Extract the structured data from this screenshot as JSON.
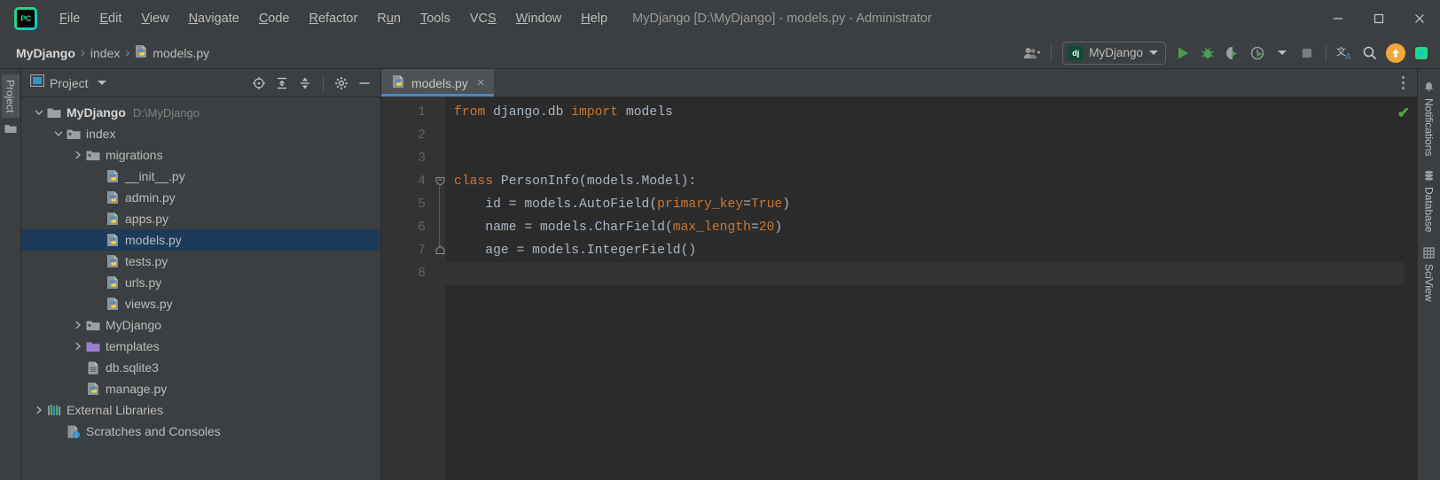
{
  "window": {
    "title": "MyDjango [D:\\MyDjango] - models.py - Administrator",
    "logo_text": "PC",
    "minimize_label": "Minimize",
    "maximize_label": "Maximize",
    "close_label": "Close"
  },
  "menubar": {
    "items": [
      {
        "label": "File",
        "mnemonic": "F"
      },
      {
        "label": "Edit",
        "mnemonic": "E"
      },
      {
        "label": "View",
        "mnemonic": "V"
      },
      {
        "label": "Navigate",
        "mnemonic": "N"
      },
      {
        "label": "Code",
        "mnemonic": "C"
      },
      {
        "label": "Refactor",
        "mnemonic": "R"
      },
      {
        "label": "Run",
        "mnemonic": "u"
      },
      {
        "label": "Tools",
        "mnemonic": "T"
      },
      {
        "label": "VCS",
        "mnemonic": "S"
      },
      {
        "label": "Window",
        "mnemonic": "W"
      },
      {
        "label": "Help",
        "mnemonic": "H"
      }
    ]
  },
  "breadcrumb": {
    "items": [
      {
        "label": "MyDjango",
        "icon": "none",
        "bold": true
      },
      {
        "label": "index",
        "icon": "none",
        "bold": false
      },
      {
        "label": "models.py",
        "icon": "python-file-icon",
        "bold": false
      }
    ],
    "separator": "›"
  },
  "toolbar": {
    "avatar_label": "Account",
    "run_config": {
      "label": "MyDjango",
      "icon_text": "dj"
    },
    "buttons": [
      {
        "name": "run-button",
        "label": "Run"
      },
      {
        "name": "debug-button",
        "label": "Debug"
      },
      {
        "name": "run-with-coverage-button",
        "label": "Run with Coverage"
      },
      {
        "name": "profile-button",
        "label": "Profile"
      },
      {
        "name": "stop-button",
        "label": "Stop"
      },
      {
        "name": "translate-button",
        "label": "Translate"
      },
      {
        "name": "search-everywhere-button",
        "label": "Search Everywhere"
      },
      {
        "name": "update-project-button",
        "label": "Update Project"
      }
    ]
  },
  "left_toolwindow_bar": {
    "tabs": [
      {
        "label": "Project",
        "icon": "folder-icon",
        "active": true
      }
    ]
  },
  "project_panel": {
    "title": "Project",
    "actions": [
      {
        "name": "select-opened-file-action",
        "label": "Select Opened File"
      },
      {
        "name": "expand-all-action",
        "label": "Expand All"
      },
      {
        "name": "collapse-all-action",
        "label": "Collapse All"
      },
      {
        "name": "settings-action",
        "label": "Settings"
      },
      {
        "name": "hide-action",
        "label": "Hide"
      }
    ],
    "tree": [
      {
        "label": "MyDjango",
        "path": "D:\\MyDjango",
        "indent": 0,
        "arrow": "down",
        "icon": "folder-icon",
        "bold": true,
        "selected": false
      },
      {
        "label": "index",
        "path": "",
        "indent": 1,
        "arrow": "down",
        "icon": "module-folder-icon",
        "bold": false,
        "selected": false
      },
      {
        "label": "migrations",
        "path": "",
        "indent": 2,
        "arrow": "right",
        "icon": "module-folder-icon",
        "bold": false,
        "selected": false
      },
      {
        "label": "__init__.py",
        "path": "",
        "indent": 3,
        "arrow": "none",
        "icon": "python-file-icon",
        "bold": false,
        "selected": false
      },
      {
        "label": "admin.py",
        "path": "",
        "indent": 3,
        "arrow": "none",
        "icon": "python-file-icon",
        "bold": false,
        "selected": false
      },
      {
        "label": "apps.py",
        "path": "",
        "indent": 3,
        "arrow": "none",
        "icon": "python-file-icon",
        "bold": false,
        "selected": false
      },
      {
        "label": "models.py",
        "path": "",
        "indent": 3,
        "arrow": "none",
        "icon": "python-file-icon",
        "bold": false,
        "selected": true
      },
      {
        "label": "tests.py",
        "path": "",
        "indent": 3,
        "arrow": "none",
        "icon": "python-file-icon",
        "bold": false,
        "selected": false
      },
      {
        "label": "urls.py",
        "path": "",
        "indent": 3,
        "arrow": "none",
        "icon": "python-file-icon",
        "bold": false,
        "selected": false
      },
      {
        "label": "views.py",
        "path": "",
        "indent": 3,
        "arrow": "none",
        "icon": "python-file-icon",
        "bold": false,
        "selected": false
      },
      {
        "label": "MyDjango",
        "path": "",
        "indent": 2,
        "arrow": "right",
        "icon": "module-folder-icon",
        "bold": false,
        "selected": false
      },
      {
        "label": "templates",
        "path": "",
        "indent": 2,
        "arrow": "right",
        "icon": "templates-folder-icon",
        "bold": false,
        "selected": false
      },
      {
        "label": "db.sqlite3",
        "path": "",
        "indent": 2,
        "arrow": "none",
        "icon": "database-file-icon",
        "bold": false,
        "selected": false
      },
      {
        "label": "manage.py",
        "path": "",
        "indent": 2,
        "arrow": "none",
        "icon": "python-file-icon",
        "bold": false,
        "selected": false
      },
      {
        "label": "External Libraries",
        "path": "",
        "indent": 0,
        "arrow": "right",
        "icon": "libraries-icon",
        "bold": false,
        "selected": false
      },
      {
        "label": "Scratches and Consoles",
        "path": "",
        "indent": 1,
        "arrow": "none",
        "icon": "scratches-icon",
        "bold": false,
        "selected": false
      }
    ]
  },
  "editor": {
    "tabs": [
      {
        "label": "models.py",
        "icon": "python-file-icon",
        "active": true,
        "close": "×"
      }
    ],
    "options_label": "Options",
    "inspection_status": "✔",
    "lines": [
      {
        "num": "1",
        "fold": "none",
        "current": false,
        "tokens": [
          {
            "t": "from ",
            "c": "kw"
          },
          {
            "t": "django.db ",
            "c": "def"
          },
          {
            "t": "import ",
            "c": "kw"
          },
          {
            "t": "models",
            "c": "def"
          }
        ]
      },
      {
        "num": "2",
        "fold": "none",
        "current": false,
        "tokens": []
      },
      {
        "num": "3",
        "fold": "none",
        "current": false,
        "tokens": []
      },
      {
        "num": "4",
        "fold": "open",
        "current": false,
        "tokens": [
          {
            "t": "class ",
            "c": "kw"
          },
          {
            "t": "PersonInfo(models.Model):",
            "c": "def"
          }
        ]
      },
      {
        "num": "5",
        "fold": "none",
        "current": false,
        "tokens": [
          {
            "t": "    id = models.AutoField(",
            "c": "def"
          },
          {
            "t": "primary_key",
            "c": "arg"
          },
          {
            "t": "=",
            "c": "def"
          },
          {
            "t": "True",
            "c": "num"
          },
          {
            "t": ")",
            "c": "def"
          }
        ]
      },
      {
        "num": "6",
        "fold": "none",
        "current": false,
        "tokens": [
          {
            "t": "    name = models.CharField(",
            "c": "def"
          },
          {
            "t": "max_length",
            "c": "arg"
          },
          {
            "t": "=",
            "c": "def"
          },
          {
            "t": "20",
            "c": "num"
          },
          {
            "t": ")",
            "c": "def"
          }
        ]
      },
      {
        "num": "7",
        "fold": "close",
        "current": false,
        "tokens": [
          {
            "t": "    age = models.IntegerField()",
            "c": "def"
          }
        ]
      },
      {
        "num": "8",
        "fold": "none",
        "current": true,
        "tokens": []
      }
    ]
  },
  "right_toolwindow_bar": {
    "tabs": [
      {
        "label": "Notifications",
        "icon": "bell-icon"
      },
      {
        "label": "Database",
        "icon": "database-icon"
      },
      {
        "label": "SciView",
        "icon": "grid-icon"
      }
    ]
  },
  "colors": {
    "accent": "#4a88c7",
    "keyword": "#cc7832",
    "selection": "#1c3b5a",
    "ok_green": "#5a9e4b",
    "update_orange": "#f2a73b"
  }
}
